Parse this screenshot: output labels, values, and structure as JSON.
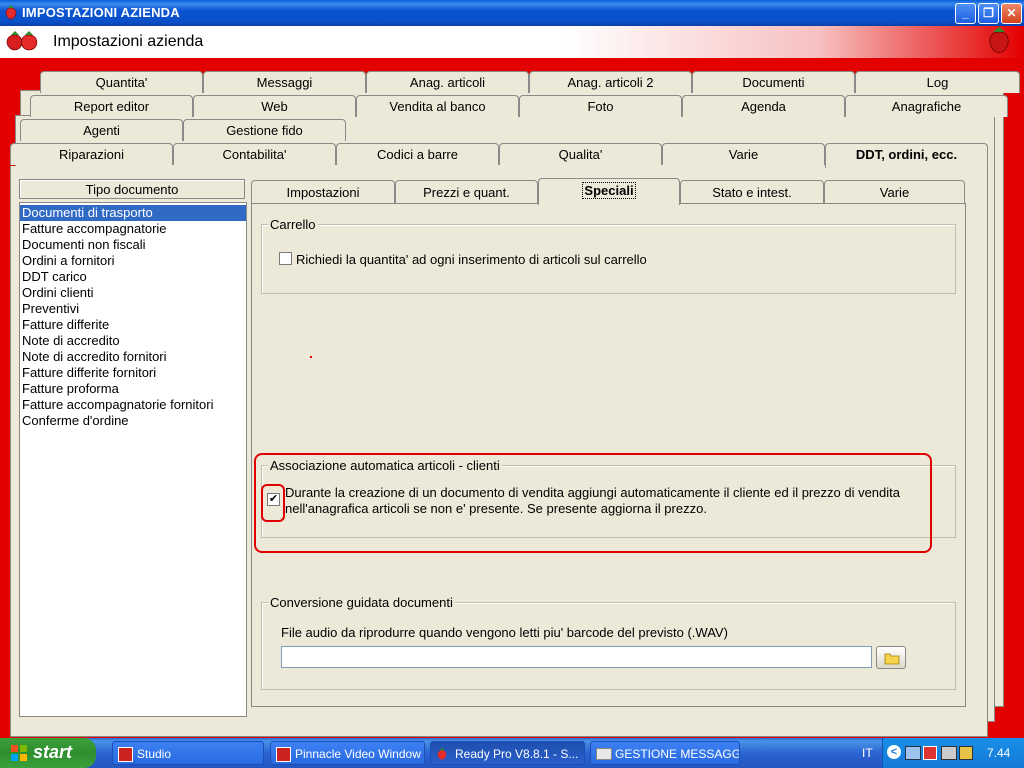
{
  "window": {
    "title": "IMPOSTAZIONI AZIENDA",
    "header_title": "Impostazioni azienda"
  },
  "title_buttons": {
    "minimize": "_",
    "restore": "❐",
    "close": "✕"
  },
  "main_tabs": {
    "row1": [
      "Quantita'",
      "Messaggi",
      "Anag. articoli",
      "Anag. articoli 2",
      "Documenti",
      "Log"
    ],
    "row2": [
      "Report editor",
      "Web",
      "Vendita al banco",
      "Foto",
      "Agenda",
      "Anagrafiche"
    ],
    "row3": [
      "Agenti",
      "Gestione fido"
    ],
    "row4": [
      "Riparazioni",
      "Contabilita'",
      "Codici a barre",
      "Qualita'",
      "Varie",
      "DDT, ordini, ecc."
    ]
  },
  "doc_type": {
    "header": "Tipo documento",
    "items": [
      "Documenti di trasporto",
      "Fatture accompagnatorie",
      "Documenti non fiscali",
      "Ordini a fornitori",
      "DDT carico",
      "Ordini clienti",
      "Preventivi",
      "Fatture differite",
      "Note di accredito",
      "Note di accredito fornitori",
      "Fatture differite fornitori",
      "Fatture proforma",
      "Fatture accompagnatorie fornitori",
      "Conferme d'ordine"
    ],
    "selected": "Documenti di trasporto"
  },
  "sub_tabs": [
    "Impostazioni",
    "Prezzi e quant.",
    "Speciali",
    "Stato e intest.",
    "Varie"
  ],
  "carrello": {
    "label": "Carrello",
    "checkbox_label": "Richiedi la quantita' ad ogni inserimento di articoli sul carrello",
    "checked": false
  },
  "associazione": {
    "label": "Associazione automatica articoli - clienti",
    "checkbox_line1": "Durante la creazione di un documento di vendita aggiungi automaticamente il cliente ed il prezzo di vendita",
    "checkbox_line2": "nell'anagrafica articoli se non e' presente. Se presente aggiorna il prezzo.",
    "checked": true,
    "check_mark": "✔"
  },
  "conversione": {
    "label": "Conversione guidata documenti",
    "field_label": "File audio da riprodurre quando vengono letti piu' barcode del previsto  (.WAV)",
    "field_value": ""
  },
  "taskbar": {
    "start_label": "start",
    "tasks": [
      "Studio",
      "Pinnacle Video Window",
      "Ready Pro V8.8.1 - S...",
      "GESTIONE MESSAGGI..."
    ],
    "language": "IT",
    "clock": "7.44"
  },
  "colors": {
    "desktop_red": "#e30000",
    "highlight": "#316ac5",
    "annotation": "#e00000"
  }
}
